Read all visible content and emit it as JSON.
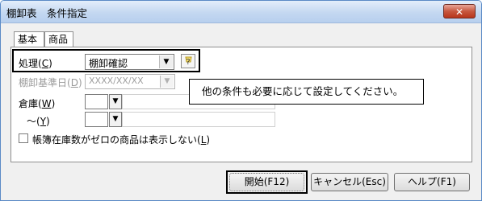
{
  "window": {
    "title": "棚卸表　条件指定",
    "close_glyph": "✕"
  },
  "tabs": [
    {
      "label": "基本"
    },
    {
      "label": "商品"
    }
  ],
  "form": {
    "process": {
      "label": "処理(",
      "key": "C",
      "suffix": ")",
      "value": "棚卸確認"
    },
    "base_date": {
      "label": "棚卸基準日(",
      "key": "D",
      "suffix": ")",
      "value": "XXXX/XX/XX"
    },
    "warehouse_from": {
      "label": "倉庫(",
      "key": "W",
      "suffix": ")"
    },
    "warehouse_to": {
      "label": "～(",
      "key": "Y",
      "suffix": ")"
    },
    "hide_zero": {
      "label": "帳簿在庫数がゼロの商品は表示しない(",
      "key": "L",
      "suffix": ")"
    }
  },
  "tooltip": {
    "text": "他の条件も必要に応じて設定してください。"
  },
  "buttons": {
    "start": {
      "label": "開始(F12)"
    },
    "cancel": {
      "label": "キャンセル(Esc)"
    },
    "help": {
      "label": "ヘルプ(F1)"
    }
  },
  "icons": {
    "dropdown": "▼",
    "picker": "▼"
  }
}
